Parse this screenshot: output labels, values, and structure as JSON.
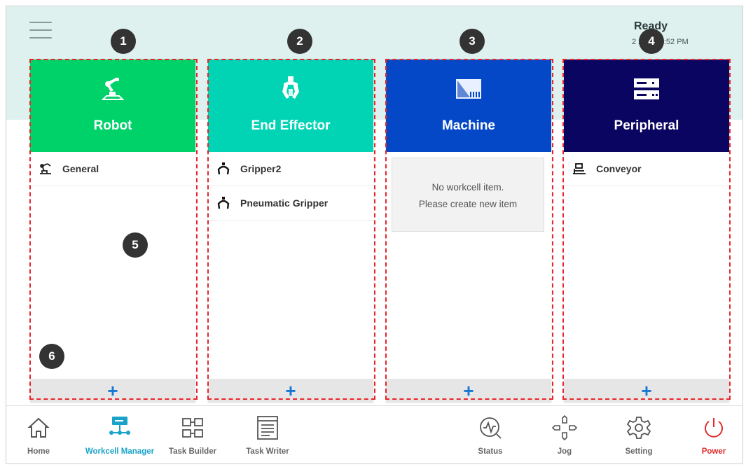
{
  "header": {
    "status": "Ready",
    "datetime": "2        26 2:31:52 PM"
  },
  "panels": [
    {
      "title": "Robot",
      "color": "#00d26a",
      "icon": "robot-arm-icon",
      "badge": "1",
      "items": [
        {
          "label": "General",
          "icon": "robot-small-icon"
        }
      ]
    },
    {
      "title": "End Effector",
      "color": "#00d4b5",
      "icon": "gripper-icon",
      "badge": "2",
      "items": [
        {
          "label": "Gripper2",
          "icon": "gripper-claw-icon"
        },
        {
          "label": "Pneumatic Gripper",
          "icon": "gripper-claw-icon"
        }
      ]
    },
    {
      "title": "Machine",
      "color": "#0448c8",
      "icon": "machine-icon",
      "badge": "3",
      "items": [],
      "empty_line1": "No workcell item.",
      "empty_line2": "Please create new item"
    },
    {
      "title": "Peripheral",
      "color": "#0b0562",
      "icon": "server-rack-icon",
      "badge": "4",
      "items": [
        {
          "label": "Conveyor",
          "icon": "conveyor-icon"
        }
      ]
    }
  ],
  "add_label": "+",
  "callouts": {
    "list_area": "5",
    "add_button": "6"
  },
  "nav": {
    "home": "Home",
    "workcell_manager": "Workcell Manager",
    "task_builder": "Task Builder",
    "task_writer": "Task Writer",
    "status": "Status",
    "jog": "Jog",
    "setting": "Setting",
    "power": "Power"
  },
  "colors": {
    "active": "#1aa3c9",
    "power": "#e02b2b",
    "add": "#1778d4",
    "callout_outline": "#e8262a"
  }
}
